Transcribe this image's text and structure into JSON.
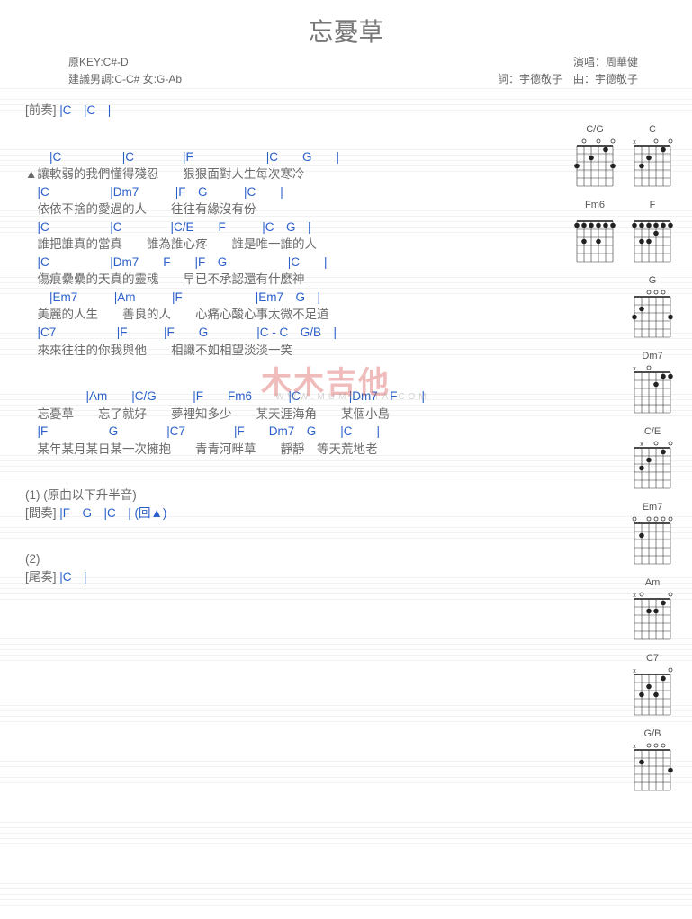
{
  "title": "忘憂草",
  "meta": {
    "left1": "原KEY:C#-D",
    "right1": "演唱：周華健",
    "left2": "建議男調:C-C# 女:G-Ab",
    "right2": "詞：宇德敬子　曲：宇德敬子"
  },
  "intro": {
    "label": "[前奏]",
    "chords": " |C　|C　|"
  },
  "verses": [
    {
      "c": "　　|C　　　　　|C　　　　|F　　　　　　|C　　G　　|",
      "l": "▲讓軟弱的我們懂得殘忍　　狠狠面對人生每次寒冷"
    },
    {
      "c": "　|C　　　　　|Dm7　　　|F　G　　　|C　　|",
      "l": "　依依不捨的愛過的人　　往往有緣沒有份"
    },
    {
      "c": "　|C　　　　　|C　　　　|C/E　　F　　　|C　G　|",
      "l": "　誰把誰真的當真　　誰為誰心疼　　誰是唯一誰的人"
    },
    {
      "c": "　|C　　　　　|Dm7　　F　　|F　G　　　　　|C　　|",
      "l": "　傷痕纍纍的天真的靈魂　　早已不承認還有什麼神"
    },
    {
      "c": "　　|Em7　　　|Am　　　|F　　　　　　|Em7　G　|",
      "l": "　美麗的人生　　善良的人　　心痛心酸心事太微不足道"
    },
    {
      "c": "　|C7　　　　　|F　　　|F　　G　　　　|C - C　G/B　|",
      "l": "　來來往往的你我與他　　相識不如相望淡淡一笑"
    }
  ],
  "chorus": [
    {
      "c": "　　　　　|Am　　|C/G　　　|F　　Fm6　　　|C　　　　|Dm7　F　　|",
      "l": "　忘憂草　　忘了就好　　夢裡知多少　　某天涯海角　　某個小島"
    },
    {
      "c": "　|F　　　　　G　　　　|C7　　　　|F　　Dm7　G　　|C　　|",
      "l": "　某年某月某日某一次擁抱　　青青河畔草　　靜靜　等天荒地老"
    }
  ],
  "inter": {
    "num": "(1)",
    "note": " (原曲以下升半音)",
    "label": "[間奏]",
    "chords": " |F　G　|C　| (回▲)"
  },
  "outro": {
    "num": "(2)",
    "label": "[尾奏]",
    "chords": " |C　|"
  },
  "watermark": "木木吉他",
  "watermark_sub": "WWW.MUMUJITA.COM",
  "chord_diagrams": [
    "C/G",
    "C",
    "Fm6",
    "F",
    "G",
    "Dm7",
    "C/E",
    "Em7",
    "Am",
    "C7",
    "G/B"
  ]
}
